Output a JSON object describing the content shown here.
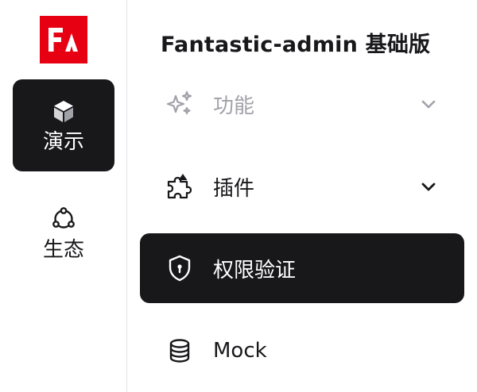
{
  "rail": {
    "logo_text": "FΛ",
    "items": [
      {
        "label": "演示",
        "icon": "cube-icon",
        "active": true
      },
      {
        "label": "生态",
        "icon": "share-nodes-icon",
        "active": false
      }
    ]
  },
  "submenu": {
    "title": "Fantastic-admin 基础版",
    "items": [
      {
        "label": "功能",
        "icon": "sparkles-icon",
        "state": "disabled",
        "has_children": true
      },
      {
        "label": "插件",
        "icon": "puzzle-icon",
        "state": "normal",
        "has_children": true
      },
      {
        "label": "权限验证",
        "icon": "shield-icon",
        "state": "active",
        "has_children": false
      },
      {
        "label": "Mock",
        "icon": "database-icon",
        "state": "normal",
        "has_children": false
      }
    ]
  },
  "colors": {
    "brand": "#e60012",
    "active_bg": "#18181b",
    "disabled_text": "#a1a1aa",
    "divider": "#e4e4e7"
  }
}
